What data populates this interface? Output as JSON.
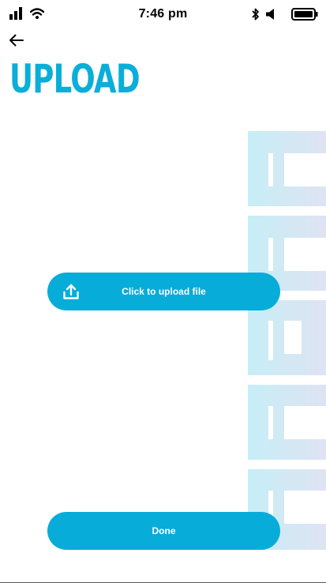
{
  "status_bar": {
    "time": "7:46 pm",
    "icons": [
      "signal-icon",
      "wifi-icon",
      "bluetooth-icon",
      "volume-mute-icon",
      "battery-icon"
    ]
  },
  "header": {
    "back_icon": "arrow-left-icon",
    "title": "UPLOAD"
  },
  "main": {
    "upload_button": {
      "label": "Click to upload file",
      "icon": "upload-icon"
    },
    "done_button": {
      "label": "Done"
    }
  },
  "colors": {
    "accent": "#08acd9",
    "watermark": "#d3eef6"
  }
}
